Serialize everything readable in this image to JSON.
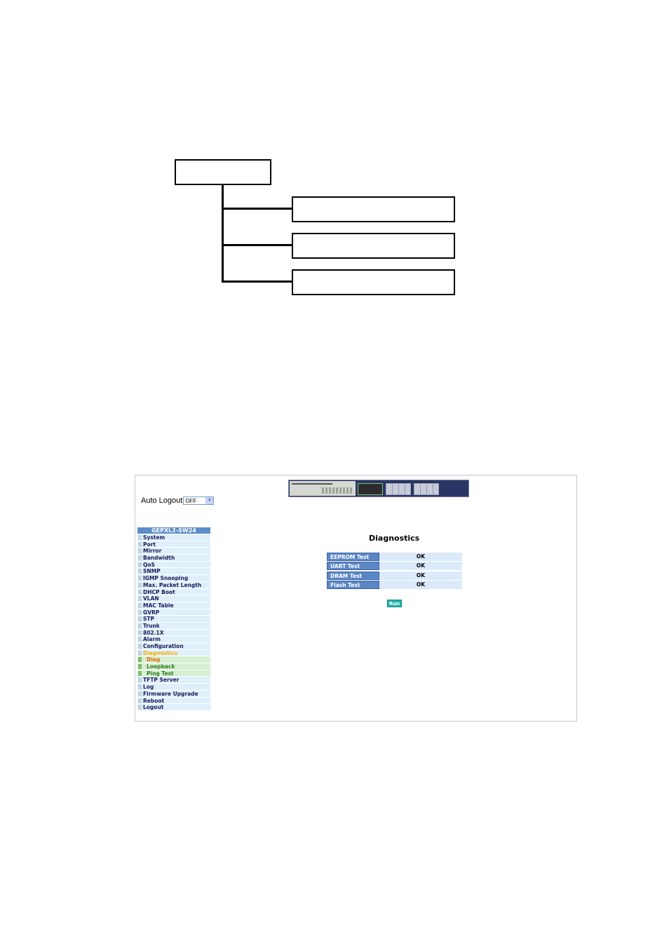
{
  "diagram": {
    "root": "",
    "children": [
      "",
      "",
      ""
    ]
  },
  "screenshot": {
    "auto_logout": {
      "label": "Auto Logout",
      "value": "OFF"
    },
    "sidebar": {
      "title": "GEPXL2-SW24",
      "items": [
        {
          "label": "System"
        },
        {
          "label": "Port"
        },
        {
          "label": "Mirror"
        },
        {
          "label": "Bandwidth"
        },
        {
          "label": "QoS"
        },
        {
          "label": "SNMP"
        },
        {
          "label": "IGMP Snooping"
        },
        {
          "label": "Max. Packet Length"
        },
        {
          "label": "DHCP Boot"
        },
        {
          "label": "VLAN"
        },
        {
          "label": "MAC Table"
        },
        {
          "label": "GVRP"
        },
        {
          "label": "STP"
        },
        {
          "label": "Trunk"
        },
        {
          "label": "802.1X"
        },
        {
          "label": "Alarm"
        },
        {
          "label": "Configuration"
        },
        {
          "label": "Diagnostics"
        }
      ],
      "subitems": [
        {
          "label": "Diag"
        },
        {
          "label": "Loopback"
        },
        {
          "label": "Ping Test"
        }
      ],
      "items_after": [
        {
          "label": "TFTP Server"
        },
        {
          "label": "Log"
        },
        {
          "label": "Firmware Upgrade"
        },
        {
          "label": "Reboot"
        },
        {
          "label": "Logout"
        }
      ]
    },
    "main": {
      "title": "Diagnostics",
      "tests": [
        {
          "label": "EEPROM Test",
          "result": "OK"
        },
        {
          "label": "UART Test",
          "result": "OK"
        },
        {
          "label": "DRAM Test",
          "result": "OK"
        },
        {
          "label": "Flash Test",
          "result": "OK"
        }
      ],
      "run_label": "Run"
    }
  }
}
